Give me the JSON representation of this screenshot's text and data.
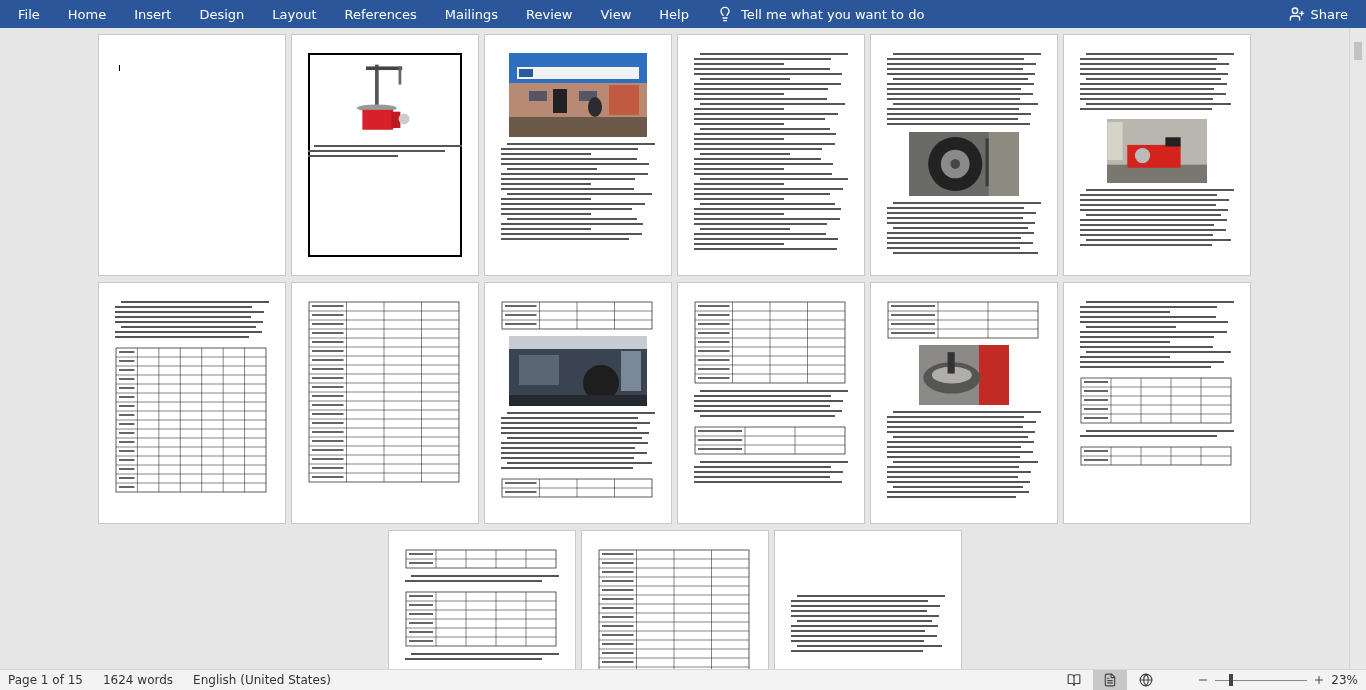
{
  "menu": {
    "tabs": [
      {
        "label": "File",
        "selected": false
      },
      {
        "label": "Home",
        "selected": false
      },
      {
        "label": "Insert",
        "selected": false
      },
      {
        "label": "Design",
        "selected": false
      },
      {
        "label": "Layout",
        "selected": false
      },
      {
        "label": "References",
        "selected": false
      },
      {
        "label": "Mailings",
        "selected": false
      },
      {
        "label": "Review",
        "selected": false
      },
      {
        "label": "View",
        "selected": false
      },
      {
        "label": "Help",
        "selected": false
      }
    ],
    "tell_me": {
      "placeholder": "Tell me what you want to do"
    },
    "share": "Share"
  },
  "pages": [
    {
      "kind": "blank"
    },
    {
      "kind": "cover"
    },
    {
      "kind": "storefront"
    },
    {
      "kind": "text"
    },
    {
      "kind": "tire"
    },
    {
      "kind": "pump"
    },
    {
      "kind": "text-table"
    },
    {
      "kind": "table"
    },
    {
      "kind": "garage"
    },
    {
      "kind": "table-text"
    },
    {
      "kind": "machine-top"
    },
    {
      "kind": "text-tables"
    },
    {
      "kind": "tables"
    },
    {
      "kind": "table"
    },
    {
      "kind": "text-low"
    }
  ],
  "status_bar": {
    "page": "Page 1 of 15",
    "words": "1624 words",
    "language": "English (United States)",
    "views": [
      {
        "kind": "read",
        "selected": false
      },
      {
        "kind": "print",
        "selected": true
      },
      {
        "kind": "web",
        "selected": false
      }
    ],
    "zoom": {
      "level": 0.15,
      "reading": "23%"
    }
  }
}
